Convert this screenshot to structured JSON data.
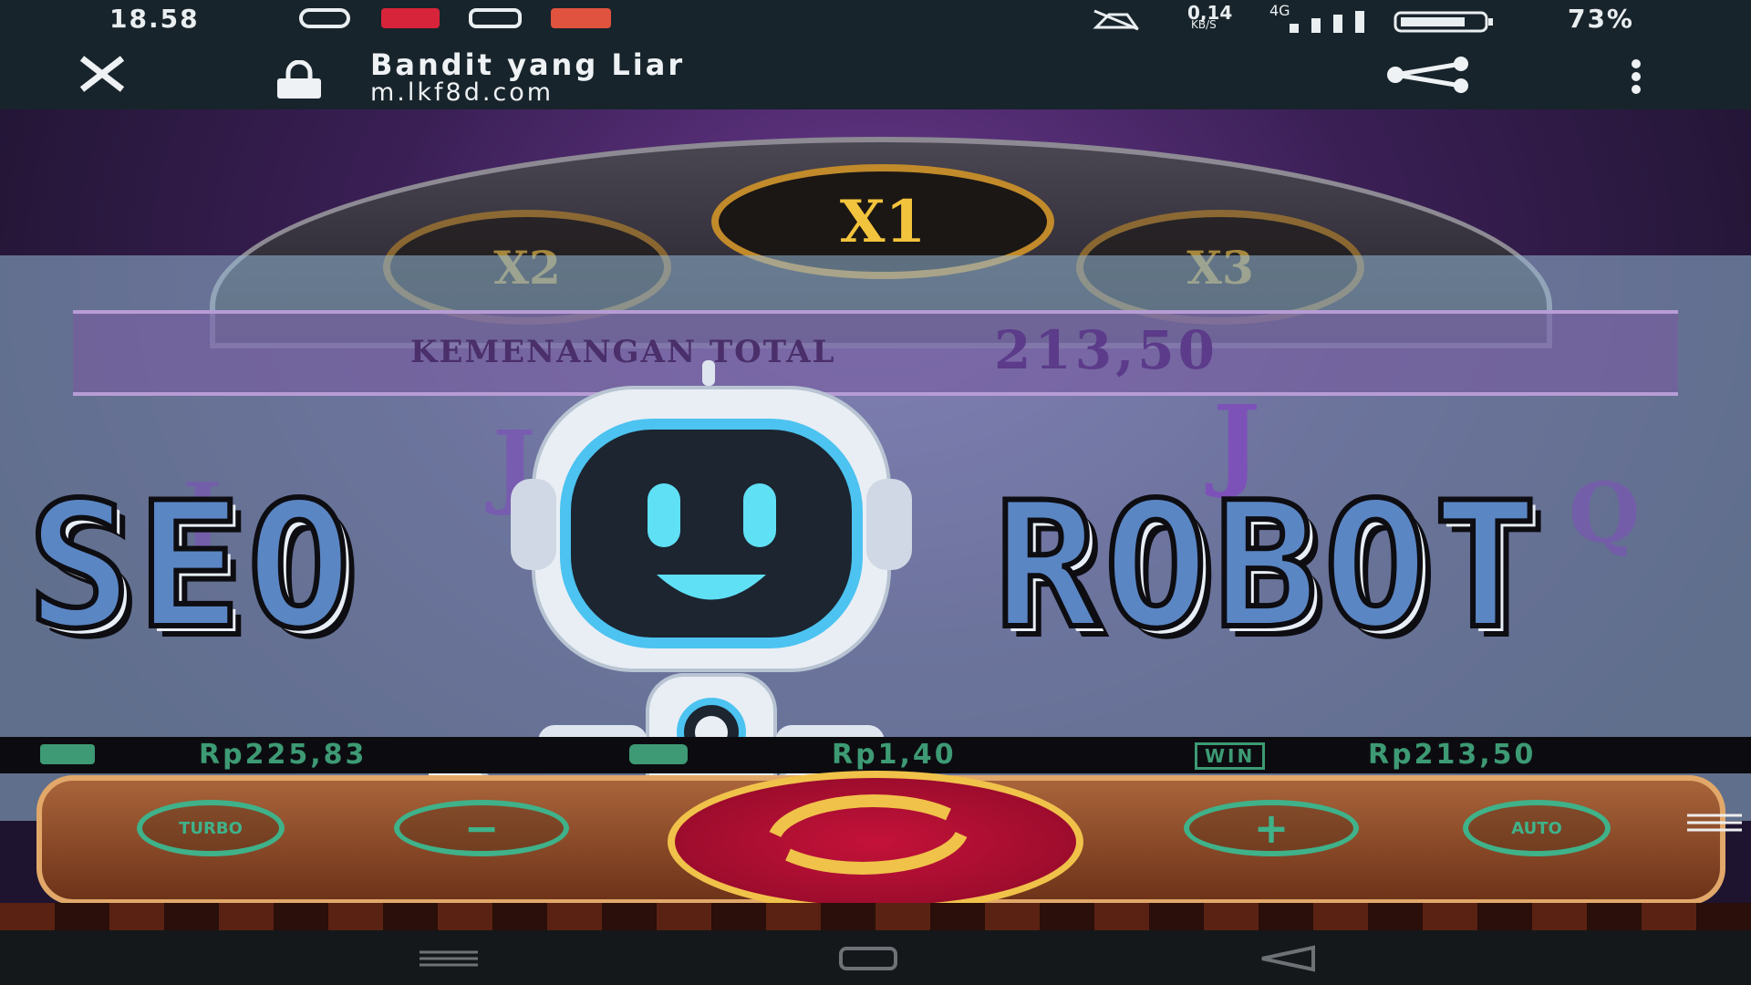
{
  "status_bar": {
    "time": "18.58",
    "battery_text": "73%",
    "network_rate": "0,14",
    "network_unit": "KB/S",
    "signal_type": "4G",
    "app_icons": [
      "whatsapp-icon",
      "app-red-icon",
      "instagram-icon",
      "music-app-icon"
    ]
  },
  "browser": {
    "title": "Bandit yang Liar",
    "url": "m.lkf8d.com"
  },
  "game": {
    "multiplier_center": "X1",
    "multiplier_left": "X2",
    "multiplier_right": "X3",
    "banner_label": "KEMENANGAN TOTAL",
    "banner_amount": "213,50",
    "reel_letters": [
      "J",
      "J",
      "J",
      "Q"
    ]
  },
  "overlay": {
    "left_word": "SEO",
    "right_word": "ROBOT"
  },
  "info_row": {
    "balance": "Rp225,83",
    "bet": "Rp1,40",
    "win": "Rp213,50",
    "win_icon_label": "WIN"
  },
  "controls": {
    "turbo_label": "TURBO",
    "minus_label": "−",
    "plus_label": "+",
    "auto_label": "AUTO"
  },
  "colors": {
    "status_bg": "#18242b",
    "accent_green": "#3fb28a",
    "spin_red": "#c4123a",
    "gold": "#f0c24a"
  }
}
